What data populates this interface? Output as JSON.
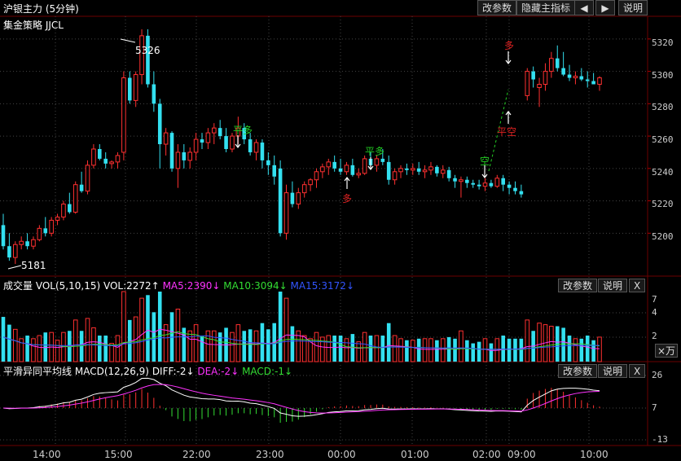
{
  "header": {
    "title": "沪银主力 (5分钟)",
    "buttons": [
      "改参数",
      "隐藏主指标",
      "◀",
      "▶",
      "说明"
    ],
    "strategy": "集金策略 JJCL"
  },
  "price_axis": {
    "ticks": [
      "5320",
      "5300",
      "5280",
      "5260",
      "5240",
      "5220",
      "5200"
    ],
    "ylim": [
      5175,
      5332
    ]
  },
  "annotations": {
    "high": "5326",
    "low": "5181"
  },
  "signals": [
    {
      "text": "平多",
      "color": "#22cc22"
    },
    {
      "text": "多",
      "color": "#dd2222"
    },
    {
      "text": "平多",
      "color": "#22cc22"
    },
    {
      "text": "空",
      "color": "#22cc22"
    },
    {
      "text": "多",
      "color": "#dd2222"
    },
    {
      "text": "平空",
      "color": "#dd2222"
    }
  ],
  "volume_panel": {
    "title": "成交量",
    "params": "VOL(5,10,15)",
    "vol": "VOL:2272↑",
    "ma5": "MA5:2390↓",
    "ma10": "MA10:3094↓",
    "ma15": "MA15:3172↓",
    "buttons": [
      "改参数",
      "说明",
      "X"
    ],
    "ticks": [
      "7",
      "4",
      "2"
    ],
    "unit": "×万"
  },
  "macd_panel": {
    "title": "平滑异同平均线",
    "params": "MACD(12,26,9)",
    "diff": "DIFF:-2↓",
    "dea": "DEA:-2↓",
    "macd": "MACD:-1↓",
    "buttons": [
      "改参数",
      "说明",
      "X"
    ],
    "ticks": [
      "26",
      "7",
      "-13"
    ]
  },
  "time_axis": [
    "14:00",
    "15:00",
    "22:00",
    "23:00",
    "00:00",
    "01:00",
    "02:00",
    "09:00",
    "10:00"
  ],
  "colors": {
    "up": "#ff3030",
    "down": "#33e0f0",
    "ma5": "#ff33ff",
    "ma10": "#33dd33",
    "ma15": "#3355ff",
    "diff": "#ffffff",
    "dea": "#ff33ff"
  },
  "chart_data": {
    "type": "candlestick",
    "ohlc": [
      [
        5205,
        5212,
        5190,
        5192
      ],
      [
        5192,
        5200,
        5183,
        5185
      ],
      [
        5185,
        5195,
        5181,
        5193
      ],
      [
        5193,
        5198,
        5190,
        5195
      ],
      [
        5195,
        5200,
        5190,
        5192
      ],
      [
        5192,
        5198,
        5190,
        5196
      ],
      [
        5196,
        5205,
        5195,
        5203
      ],
      [
        5203,
        5210,
        5198,
        5200
      ],
      [
        5200,
        5210,
        5198,
        5208
      ],
      [
        5208,
        5212,
        5205,
        5210
      ],
      [
        5210,
        5220,
        5208,
        5218
      ],
      [
        5218,
        5225,
        5212,
        5213
      ],
      [
        5213,
        5232,
        5212,
        5230
      ],
      [
        5230,
        5238,
        5225,
        5226
      ],
      [
        5226,
        5245,
        5224,
        5242
      ],
      [
        5242,
        5255,
        5240,
        5252
      ],
      [
        5252,
        5255,
        5245,
        5246
      ],
      [
        5246,
        5250,
        5240,
        5243
      ],
      [
        5243,
        5245,
        5240,
        5244
      ],
      [
        5244,
        5250,
        5240,
        5248
      ],
      [
        5250,
        5300,
        5245,
        5296
      ],
      [
        5296,
        5300,
        5280,
        5282
      ],
      [
        5282,
        5300,
        5278,
        5298
      ],
      [
        5298,
        5326,
        5292,
        5322
      ],
      [
        5322,
        5326,
        5290,
        5292
      ],
      [
        5292,
        5300,
        5275,
        5280
      ],
      [
        5280,
        5283,
        5240,
        5255
      ],
      [
        5255,
        5265,
        5248,
        5262
      ],
      [
        5262,
        5263,
        5238,
        5240
      ],
      [
        5240,
        5255,
        5228,
        5250
      ],
      [
        5250,
        5255,
        5240,
        5245
      ],
      [
        5245,
        5253,
        5240,
        5250
      ],
      [
        5250,
        5262,
        5245,
        5258
      ],
      [
        5258,
        5262,
        5252,
        5256
      ],
      [
        5256,
        5265,
        5252,
        5262
      ],
      [
        5262,
        5268,
        5255,
        5265
      ],
      [
        5265,
        5270,
        5258,
        5260
      ],
      [
        5260,
        5265,
        5250,
        5252
      ],
      [
        5252,
        5262,
        5250,
        5260
      ],
      [
        5260,
        5272,
        5255,
        5265
      ],
      [
        5265,
        5268,
        5255,
        5258
      ],
      [
        5258,
        5262,
        5248,
        5250
      ],
      [
        5250,
        5258,
        5245,
        5256
      ],
      [
        5256,
        5258,
        5240,
        5245
      ],
      [
        5245,
        5250,
        5236,
        5242
      ],
      [
        5242,
        5248,
        5230,
        5235
      ],
      [
        5240,
        5245,
        5198,
        5200
      ],
      [
        5200,
        5230,
        5196,
        5225
      ],
      [
        5225,
        5232,
        5216,
        5218
      ],
      [
        5218,
        5228,
        5215,
        5225
      ],
      [
        5225,
        5232,
        5222,
        5230
      ],
      [
        5230,
        5234,
        5226,
        5233
      ],
      [
        5233,
        5240,
        5228,
        5238
      ],
      [
        5238,
        5243,
        5234,
        5241
      ],
      [
        5241,
        5246,
        5236,
        5244
      ],
      [
        5244,
        5248,
        5238,
        5240
      ],
      [
        5240,
        5246,
        5236,
        5238
      ],
      [
        5238,
        5244,
        5236,
        5242
      ],
      [
        5242,
        5246,
        5235,
        5236
      ],
      [
        5236,
        5240,
        5234,
        5237
      ],
      [
        5237,
        5248,
        5236,
        5246
      ],
      [
        5246,
        5250,
        5240,
        5242
      ],
      [
        5242,
        5248,
        5238,
        5246
      ],
      [
        5246,
        5252,
        5242,
        5244
      ],
      [
        5244,
        5248,
        5230,
        5233
      ],
      [
        5233,
        5240,
        5230,
        5238
      ],
      [
        5238,
        5242,
        5234,
        5240
      ],
      [
        5240,
        5243,
        5236,
        5239
      ],
      [
        5239,
        5243,
        5236,
        5240
      ],
      [
        5240,
        5244,
        5236,
        5238
      ],
      [
        5238,
        5242,
        5234,
        5239
      ],
      [
        5239,
        5244,
        5236,
        5241
      ],
      [
        5241,
        5242,
        5235,
        5237
      ],
      [
        5237,
        5242,
        5234,
        5239
      ],
      [
        5239,
        5241,
        5232,
        5234
      ],
      [
        5234,
        5236,
        5228,
        5232
      ],
      [
        5232,
        5235,
        5222,
        5233
      ],
      [
        5233,
        5235,
        5228,
        5231
      ],
      [
        5231,
        5233,
        5228,
        5230
      ],
      [
        5230,
        5233,
        5227,
        5229
      ],
      [
        5229,
        5234,
        5226,
        5231
      ],
      [
        5231,
        5233,
        5228,
        5229
      ],
      [
        5229,
        5236,
        5228,
        5234
      ],
      [
        5234,
        5236,
        5226,
        5230
      ],
      [
        5230,
        5232,
        5224,
        5228
      ],
      [
        5228,
        5232,
        5224,
        5226
      ],
      [
        5226,
        5230,
        5222,
        5224
      ],
      [
        5285,
        5302,
        5282,
        5300
      ],
      [
        5300,
        5303,
        5290,
        5295
      ],
      [
        5290,
        5296,
        5278,
        5292
      ],
      [
        5292,
        5305,
        5288,
        5300
      ],
      [
        5300,
        5312,
        5296,
        5308
      ],
      [
        5308,
        5316,
        5300,
        5302
      ],
      [
        5302,
        5312,
        5297,
        5298
      ],
      [
        5298,
        5304,
        5294,
        5296
      ],
      [
        5296,
        5300,
        5292,
        5297
      ],
      [
        5297,
        5302,
        5294,
        5295
      ],
      [
        5295,
        5300,
        5290,
        5294
      ],
      [
        5294,
        5299,
        5292,
        5292
      ],
      [
        5292,
        5297,
        5288,
        5296
      ]
    ]
  }
}
